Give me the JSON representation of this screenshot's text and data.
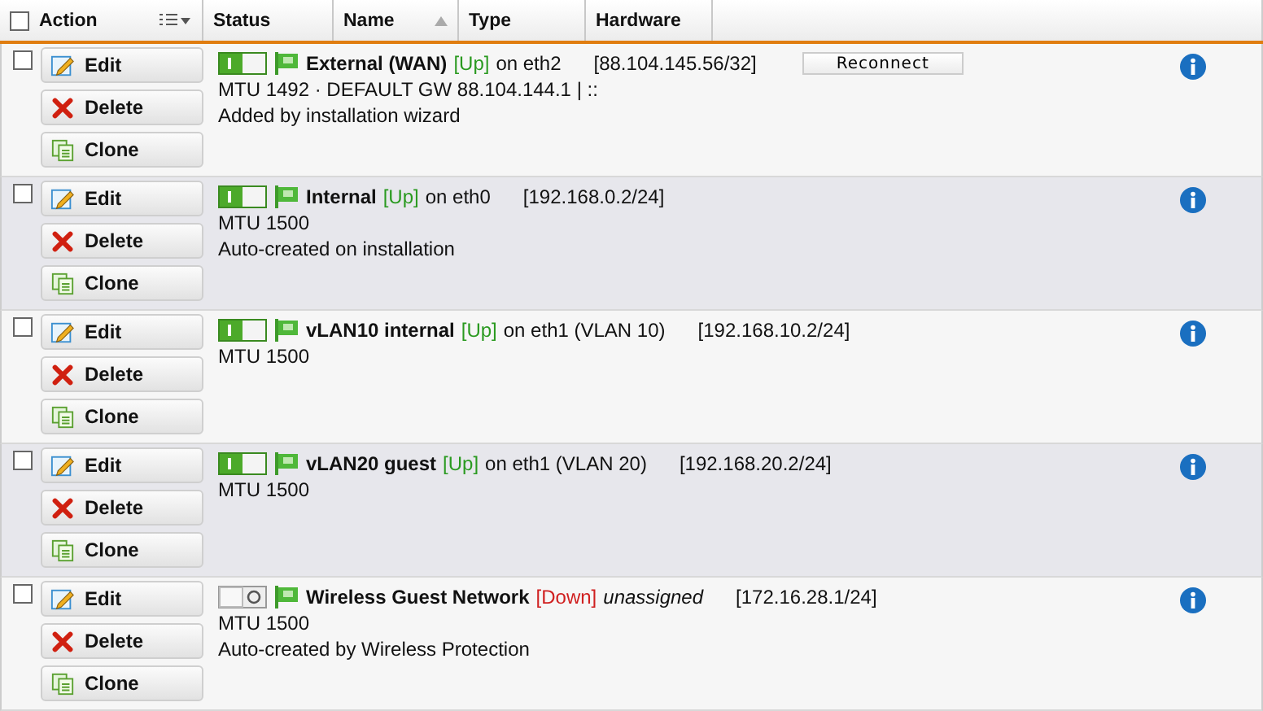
{
  "header": {
    "select_all_checked": false,
    "columns": [
      "Action",
      "Status",
      "Name",
      "Type",
      "Hardware"
    ]
  },
  "rows": [
    {
      "selected": false,
      "enabled": true,
      "name": "External (WAN)",
      "state": "[Up]",
      "up": true,
      "interface": "on eth2",
      "assigned": true,
      "address": "[88.104.145.56/32]",
      "reconnect": "Reconnect",
      "lines": [
        "MTU 1492 · DEFAULT GW 88.104.144.1 | ::",
        "Added by installation wizard"
      ],
      "actions": [
        "Edit",
        "Delete",
        "Clone"
      ]
    },
    {
      "selected": false,
      "enabled": true,
      "name": "Internal",
      "state": "[Up]",
      "up": true,
      "interface": "on eth0",
      "assigned": true,
      "address": "[192.168.0.2/24]",
      "lines": [
        "MTU 1500",
        "Auto-created on installation"
      ],
      "actions": [
        "Edit",
        "Delete",
        "Clone"
      ]
    },
    {
      "selected": false,
      "enabled": true,
      "name": "vLAN10 internal",
      "state": "[Up]",
      "up": true,
      "interface": "on eth1 (VLAN 10)",
      "assigned": true,
      "address": "[192.168.10.2/24]",
      "lines": [
        "MTU 1500"
      ],
      "actions": [
        "Edit",
        "Delete",
        "Clone"
      ]
    },
    {
      "selected": false,
      "enabled": true,
      "name": "vLAN20 guest",
      "state": "[Up]",
      "up": true,
      "interface": "on eth1 (VLAN 20)",
      "assigned": true,
      "address": "[192.168.20.2/24]",
      "lines": [
        "MTU 1500"
      ],
      "actions": [
        "Edit",
        "Delete",
        "Clone"
      ]
    },
    {
      "selected": false,
      "enabled": false,
      "name": "Wireless Guest Network",
      "state": "[Down]",
      "up": false,
      "interface": "unassigned",
      "assigned": false,
      "address": "[172.16.28.1/24]",
      "lines": [
        "MTU 1500",
        "Auto-created by Wireless Protection"
      ],
      "actions": [
        "Edit",
        "Delete",
        "Clone"
      ]
    }
  ]
}
